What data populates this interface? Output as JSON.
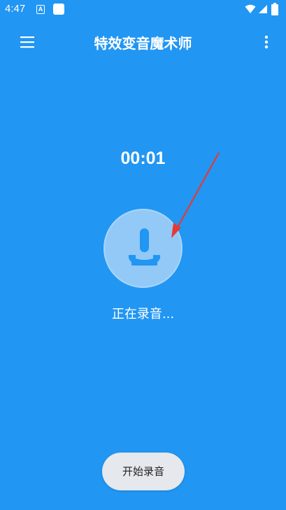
{
  "status_bar": {
    "time": "4:47",
    "notification_letter": "A"
  },
  "app_bar": {
    "title": "特效变音魔术师"
  },
  "recorder": {
    "timer": "00:01",
    "status_text": "正在录音..."
  },
  "actions": {
    "start_button_label": "开始录音"
  },
  "colors": {
    "background": "#2196f3",
    "mic_circle": "#92c9f7",
    "mic_icon": "#2196f3",
    "arrow": "#e53935",
    "button_bg": "#e5e8ec"
  },
  "icons": [
    "menu-icon",
    "more-vert-icon",
    "microphone-icon",
    "wifi-icon",
    "signal-icon",
    "battery-icon"
  ]
}
